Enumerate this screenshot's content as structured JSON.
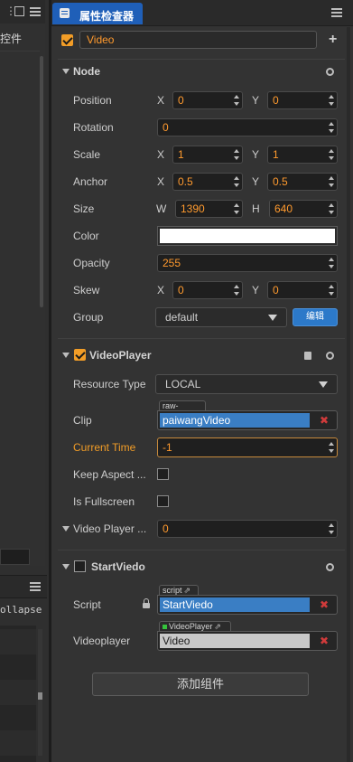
{
  "left_panel": {
    "tab_label": "控件",
    "collapse_text": "ollapse"
  },
  "inspector": {
    "tab_title": "属性检查器",
    "node_name": "Video",
    "node_enabled": true
  },
  "node_section": {
    "title": "Node",
    "position": {
      "label": "Position",
      "x_axis": "X",
      "x": "0",
      "y_axis": "Y",
      "y": "0"
    },
    "rotation": {
      "label": "Rotation",
      "value": "0"
    },
    "scale": {
      "label": "Scale",
      "x_axis": "X",
      "x": "1",
      "y_axis": "Y",
      "y": "1"
    },
    "anchor": {
      "label": "Anchor",
      "x_axis": "X",
      "x": "0.5",
      "y_axis": "Y",
      "y": "0.5"
    },
    "size": {
      "label": "Size",
      "w_axis": "W",
      "w": "1390",
      "h_axis": "H",
      "h": "640"
    },
    "color": {
      "label": "Color",
      "value": "#ffffff"
    },
    "opacity": {
      "label": "Opacity",
      "value": "255"
    },
    "skew": {
      "label": "Skew",
      "x_axis": "X",
      "x": "0",
      "y_axis": "Y",
      "y": "0"
    },
    "group": {
      "label": "Group",
      "value": "default",
      "edit_button": "编辑"
    }
  },
  "videoplayer_section": {
    "title": "VideoPlayer",
    "enabled": true,
    "resource_type": {
      "label": "Resource Type",
      "value": "LOCAL"
    },
    "clip": {
      "label": "Clip",
      "tag": "raw-asset",
      "value": "paiwangVideo"
    },
    "current_time": {
      "label": "Current Time",
      "value": "-1"
    },
    "keep_aspect": {
      "label": "Keep Aspect ...",
      "checked": false
    },
    "is_fullscreen": {
      "label": "Is Fullscreen",
      "checked": false
    },
    "video_player_event": {
      "label": "Video Player ...",
      "value": "0"
    }
  },
  "startviedo_section": {
    "title": "StartViedo",
    "enabled": false,
    "script": {
      "label": "Script",
      "tag": "script",
      "value": "StartViedo"
    },
    "videoplayer": {
      "label": "Videoplayer",
      "tag": "VideoPlayer",
      "value": "Video"
    }
  },
  "add_component_button": "添加组件",
  "colors": {
    "accent_orange": "#f29d27",
    "selection_blue": "#3a7ec4",
    "tab_blue": "#1f5fb8",
    "remove_red": "#d13b3b"
  }
}
